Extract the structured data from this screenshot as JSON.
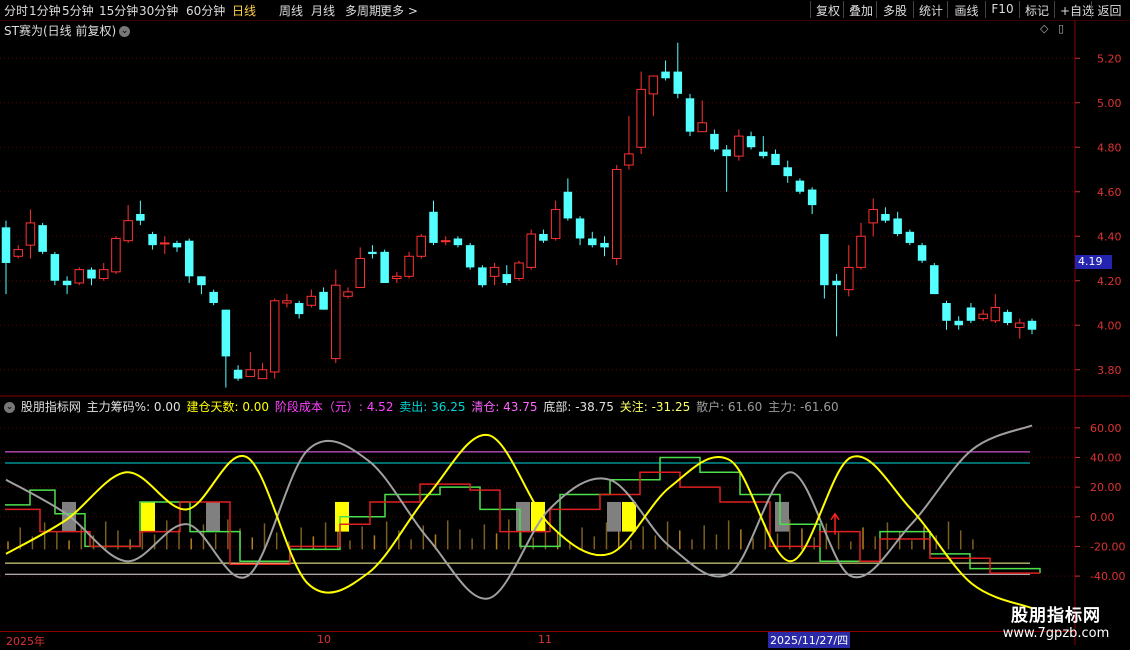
{
  "periods": [
    "分时",
    "1分钟",
    "5分钟",
    "15分钟",
    "30分钟",
    "60分钟",
    "日线",
    "周线",
    "月线",
    "多周期",
    "更多 >"
  ],
  "active_period": "日线",
  "toolbar": [
    "复权",
    "叠加",
    "多股",
    "统计",
    "画线",
    "F10",
    "标记",
    "+自选",
    "返回"
  ],
  "stock_title": "ST赛为(日线 前复权)",
  "price_axis": [
    "5.20",
    "5.00",
    "4.80",
    "4.60",
    "4.40",
    "4.20",
    "4.00",
    "3.80"
  ],
  "price_tag": "4.19",
  "indicator": {
    "name": "股朋指标网",
    "fields": [
      {
        "label": "主力筹码%:",
        "value": "0.00",
        "color": "#e0e0e0"
      },
      {
        "label": "建仓天数:",
        "value": "0.00",
        "color": "#ffff00"
      },
      {
        "label": "阶段成本（元）:",
        "value": "4.52",
        "color": "#ff44ff"
      },
      {
        "label": "卖出:",
        "value": "36.25",
        "color": "#00d8d8"
      },
      {
        "label": "清仓:",
        "value": "43.75",
        "color": "#ff66ff"
      },
      {
        "label": "底部:",
        "value": "-38.75",
        "color": "#e0e0e0"
      },
      {
        "label": "关注:",
        "value": "-31.25",
        "color": "#ffff66"
      },
      {
        "label": "散户:",
        "value": "61.60",
        "color": "#9a9a9a"
      },
      {
        "label": "主力:",
        "value": "-61.60",
        "color": "#9a9a9a"
      }
    ]
  },
  "indicator_axis": [
    "60.00",
    "40.00",
    "20.00",
    "0.00",
    "-20.00",
    "-40.00"
  ],
  "dates": [
    "2025年",
    "10",
    "11"
  ],
  "date_cursor": "2025/11/27/四",
  "watermark": {
    "line1": "股朋指标网",
    "line2": "www.7gpzb.com"
  },
  "colors": {
    "up": "#ff3232",
    "down": "#54ffff",
    "yellow": "#ffff00",
    "gray": "#a0a0a0",
    "green": "#4ce04c",
    "red": "#e02020"
  },
  "chart_data": [
    {
      "type": "candlestick",
      "title": "ST赛为(日线 前复权)",
      "ylim": [
        3.7,
        5.3
      ],
      "candles": [
        [
          4.44,
          4.28,
          4.47,
          4.14
        ],
        [
          4.31,
          4.34,
          4.36,
          4.3
        ],
        [
          4.36,
          4.46,
          4.52,
          4.3
        ],
        [
          4.45,
          4.33,
          4.46,
          4.32
        ],
        [
          4.32,
          4.2,
          4.33,
          4.18
        ],
        [
          4.2,
          4.18,
          4.22,
          4.14
        ],
        [
          4.19,
          4.25,
          4.26,
          4.18
        ],
        [
          4.25,
          4.21,
          4.26,
          4.18
        ],
        [
          4.21,
          4.25,
          4.28,
          4.2
        ],
        [
          4.24,
          4.39,
          4.4,
          4.23
        ],
        [
          4.38,
          4.47,
          4.54,
          4.37
        ],
        [
          4.5,
          4.47,
          4.56,
          4.45
        ],
        [
          4.41,
          4.36,
          4.42,
          4.34
        ],
        [
          4.37,
          4.37,
          4.4,
          4.32
        ],
        [
          4.37,
          4.35,
          4.38,
          4.33
        ],
        [
          4.38,
          4.22,
          4.39,
          4.19
        ],
        [
          4.22,
          4.18,
          4.22,
          4.14
        ],
        [
          4.15,
          4.1,
          4.16,
          4.09
        ],
        [
          4.07,
          3.86,
          4.07,
          3.72
        ],
        [
          3.8,
          3.76,
          3.82,
          3.75
        ],
        [
          3.77,
          3.8,
          3.88,
          3.77
        ],
        [
          3.76,
          3.8,
          3.83,
          3.76
        ],
        [
          3.79,
          4.11,
          4.12,
          3.76
        ],
        [
          4.1,
          4.11,
          4.14,
          4.08
        ],
        [
          4.1,
          4.05,
          4.11,
          4.03
        ],
        [
          4.09,
          4.13,
          4.16,
          4.08
        ],
        [
          4.15,
          4.07,
          4.17,
          4.07
        ],
        [
          3.85,
          4.18,
          4.25,
          3.83
        ],
        [
          4.13,
          4.15,
          4.17,
          4.12
        ],
        [
          4.17,
          4.3,
          4.35,
          4.17
        ],
        [
          4.33,
          4.32,
          4.36,
          4.3
        ],
        [
          4.33,
          4.19,
          4.34,
          4.19
        ],
        [
          4.21,
          4.22,
          4.24,
          4.19
        ],
        [
          4.22,
          4.31,
          4.33,
          4.21
        ],
        [
          4.31,
          4.4,
          4.41,
          4.3
        ],
        [
          4.51,
          4.37,
          4.56,
          4.36
        ],
        [
          4.38,
          4.38,
          4.4,
          4.36
        ],
        [
          4.39,
          4.36,
          4.4,
          4.35
        ],
        [
          4.36,
          4.26,
          4.37,
          4.25
        ],
        [
          4.26,
          4.18,
          4.27,
          4.17
        ],
        [
          4.22,
          4.26,
          4.28,
          4.18
        ],
        [
          4.23,
          4.19,
          4.27,
          4.18
        ],
        [
          4.21,
          4.28,
          4.29,
          4.2
        ],
        [
          4.26,
          4.41,
          4.43,
          4.25
        ],
        [
          4.41,
          4.38,
          4.43,
          4.37
        ],
        [
          4.39,
          4.52,
          4.56,
          4.38
        ],
        [
          4.6,
          4.48,
          4.66,
          4.47
        ],
        [
          4.48,
          4.39,
          4.49,
          4.36
        ],
        [
          4.39,
          4.36,
          4.42,
          4.35
        ],
        [
          4.37,
          4.35,
          4.4,
          4.31
        ],
        [
          4.3,
          4.7,
          4.72,
          4.27
        ],
        [
          4.72,
          4.77,
          4.94,
          4.7
        ],
        [
          4.8,
          5.06,
          5.14,
          4.77
        ],
        [
          5.04,
          5.12,
          5.12,
          4.94
        ],
        [
          5.14,
          5.11,
          5.19,
          5.1
        ],
        [
          5.14,
          5.04,
          5.27,
          5.02
        ],
        [
          5.02,
          4.87,
          5.04,
          4.85
        ],
        [
          4.87,
          4.91,
          5.01,
          4.87
        ],
        [
          4.86,
          4.79,
          4.88,
          4.78
        ],
        [
          4.79,
          4.76,
          4.81,
          4.6
        ],
        [
          4.76,
          4.85,
          4.88,
          4.74
        ],
        [
          4.85,
          4.8,
          4.87,
          4.79
        ],
        [
          4.78,
          4.76,
          4.85,
          4.75
        ],
        [
          4.77,
          4.72,
          4.79,
          4.72
        ],
        [
          4.71,
          4.67,
          4.74,
          4.64
        ],
        [
          4.65,
          4.6,
          4.66,
          4.59
        ],
        [
          4.61,
          4.54,
          4.62,
          4.5
        ],
        [
          4.41,
          4.18,
          4.41,
          4.12
        ],
        [
          4.2,
          4.18,
          4.23,
          3.95
        ],
        [
          4.16,
          4.26,
          4.36,
          4.13
        ],
        [
          4.26,
          4.4,
          4.46,
          4.25
        ],
        [
          4.46,
          4.52,
          4.57,
          4.4
        ],
        [
          4.5,
          4.47,
          4.53,
          4.46
        ],
        [
          4.48,
          4.41,
          4.51,
          4.4
        ],
        [
          4.42,
          4.37,
          4.43,
          4.36
        ],
        [
          4.36,
          4.29,
          4.37,
          4.28
        ],
        [
          4.27,
          4.14,
          4.28,
          4.14
        ],
        [
          4.1,
          4.02,
          4.11,
          3.98
        ],
        [
          4.02,
          4.0,
          4.04,
          3.98
        ],
        [
          4.08,
          4.02,
          4.1,
          4.01
        ],
        [
          4.03,
          4.05,
          4.07,
          4.02
        ],
        [
          4.02,
          4.08,
          4.14,
          4.01
        ],
        [
          4.06,
          4.01,
          4.07,
          4.0
        ],
        [
          3.99,
          4.01,
          4.03,
          3.94
        ],
        [
          4.02,
          3.98,
          4.03,
          3.96
        ]
      ]
    },
    {
      "type": "line",
      "title": "股朋指标网",
      "ylim": [
        -75,
        72
      ],
      "x": [
        0,
        5,
        10,
        15,
        20,
        25,
        30,
        35,
        40,
        45,
        50,
        55,
        60,
        65,
        70,
        75,
        80,
        85
      ],
      "series": [
        {
          "name": "散户",
          "values": [
            25,
            2,
            -30,
            -5,
            -40,
            45,
            38,
            -15,
            -55,
            5,
            25,
            -20,
            -38,
            30,
            -40,
            -5,
            45,
            61.6
          ]
        },
        {
          "name": "主力",
          "values": [
            -25,
            -2,
            30,
            5,
            40,
            -45,
            -38,
            15,
            55,
            -5,
            -25,
            20,
            38,
            -30,
            40,
            5,
            -45,
            -61.6
          ]
        }
      ]
    }
  ]
}
